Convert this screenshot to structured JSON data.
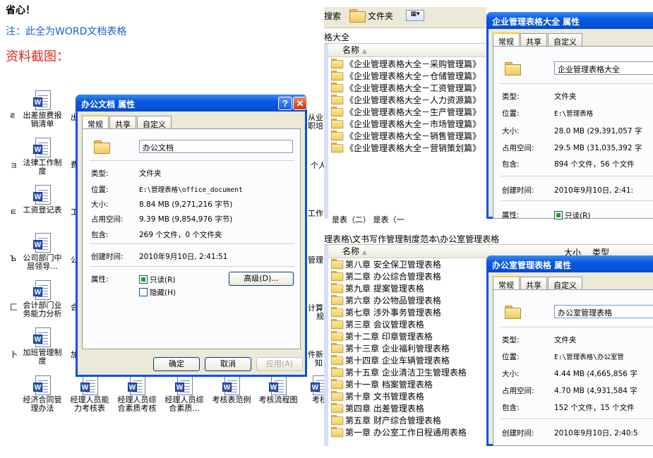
{
  "notes": {
    "line1": "省心！",
    "line2": "注：此全为WORD文档表格",
    "line3": "资料截图："
  },
  "desktop": {
    "icon_labels": [
      [
        "出差旅费报",
        "销清单"
      ],
      [
        "法律工作制",
        "度"
      ],
      [
        "工资登记表"
      ],
      [
        "公司部门中",
        "层领导..."
      ],
      [
        "会计部门业",
        "务能力分析"
      ],
      [
        "加班管理制",
        "度"
      ],
      [
        "经济合同管",
        "理办法"
      ],
      [
        "经理人员能",
        "力考核表"
      ],
      [
        "经理人员综",
        "合素质考核"
      ],
      [
        "经理人员综",
        "合素质..."
      ],
      [
        "考核表范例"
      ],
      [
        "考核流程图"
      ],
      [
        "考核"
      ]
    ],
    "right_stubs": [
      "从业",
      "职培",
      "个人",
      "工作",
      "管理",
      "计算",
      "规",
      "件新",
      "知"
    ],
    "col_glyphs": [
      "⋷",
      "ョ",
      "ㅌ",
      "Ъ",
      "匚",
      "卜"
    ],
    "mid_stubs": [
      "出",
      "费",
      "工",
      "公",
      "会",
      "加"
    ]
  },
  "dialog_office": {
    "title": "办公文档  属性",
    "help_btn": "?",
    "close_btn": "✕",
    "tabs": [
      "常规",
      "共享",
      "自定义"
    ],
    "name": "办公文档",
    "type_label": "类型:",
    "type_value": "文件夹",
    "location_label": "位置:",
    "location_value": "E:\\管理表格\\office_document",
    "size_label": "大小:",
    "size_value": "8.84 MB (9,271,216 字节)",
    "disk_label": "占用空间:",
    "disk_value": "9.39 MB (9,854,976 字节)",
    "contains_label": "包含:",
    "contains_value": "269 个文件，0 个文件夹",
    "created_label": "创建时间:",
    "created_value": "2010年9月10日, 2:41:51",
    "attr_label": "属性:",
    "readonly_label": "只读(R)",
    "hidden_label": "隐藏(H)",
    "advanced_btn": "高级(D)...",
    "ok_btn": "确定",
    "cancel_btn": "取消",
    "apply_btn": "应用(A)"
  },
  "explorer_top": {
    "toolbar_search": "搜索",
    "toolbar_folders": "文件夹",
    "address": "格大全",
    "col_name": "名称",
    "items": [
      "《企业管理表格大全－采购管理篇》",
      "《企业管理表格大全－仓储管理篇》",
      "《企业管理表格大全－工资管理篇》",
      "《企业管理表格大全－人力资源篇》",
      "《企业管理表格大全－生产管理篇》",
      "《企业管理表格大全－市场管理篇》",
      "《企业管理表格大全－销售管理篇》",
      "《企业管理表格大全－营销策划篇》"
    ],
    "bottom_stub": "是表（二）   是表（一"
  },
  "dialog_enterprise": {
    "title": "企业管理表格大全  属性",
    "tabs": [
      "常规",
      "共享",
      "自定义"
    ],
    "name": "企业管理表格大全",
    "type_label": "类型:",
    "type_value": "文件夹",
    "location_label": "位置:",
    "location_value": "E:\\管理表格",
    "size_label": "大小:",
    "size_value": "28.0 MB (29,391,057 字",
    "disk_label": "占用空间:",
    "disk_value": "29.5 MB (31,035,392 字",
    "contains_label": "包含:",
    "contains_value": "894 个文件，56 个文件",
    "created_label": "创建时间:",
    "created_value": "2010年9月10日, 2:41:",
    "attr_label": "属性:",
    "readonly_label": "只读(R)"
  },
  "explorer_bottom": {
    "address": "理表格\\文书写作管理制度范本\\办公室管理表格",
    "col_name": "名称",
    "col_size": "大小",
    "col_type": "类型",
    "items": [
      "第八章 安全保卫管理表格",
      "第二章 办公综合管理表格",
      "第九章 提案管理表格",
      "第六章 办公物品管理表格",
      "第七章 涉外事务管理表格",
      "第三章 会议管理表格",
      "第十二章  印章管理表格",
      "第十三章 企业福利管理表格",
      "第十四章 企业车辆管理表格",
      "第十五章  企业清洁卫生管理表格",
      "第十一章 档案管理表格",
      "第十章 文书管理表格",
      "第四章 出差管理表格",
      "第五章 财产综合管理表格",
      "第一章 办公室工作日程通用表格"
    ]
  },
  "dialog_officeroom": {
    "title": "办公室管理表格  属性",
    "tabs": [
      "常规",
      "共享",
      "自定义"
    ],
    "name": "办公室管理表格",
    "type_label": "类型:",
    "type_value": "文件夹",
    "location_label": "位置:",
    "location_value": "E:\\管理表格\\办公室管",
    "size_label": "大小:",
    "size_value": "4.44 MB (4,665,856 字",
    "disk_label": "占用空间:",
    "disk_value": "4.70 MB (4,931,584 字",
    "contains_label": "包含:",
    "contains_value": "152 个文件，15 个文件",
    "created_label": "创建时间:",
    "created_value": "2010年9月10日, 2:40:5"
  }
}
